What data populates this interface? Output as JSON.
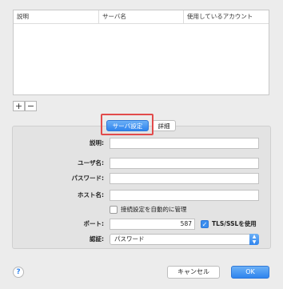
{
  "table": {
    "columns": [
      "説明",
      "サーバ名",
      "使用しているアカウント"
    ]
  },
  "list_controls": {
    "add": "+",
    "remove": "−"
  },
  "tabs": {
    "server_settings": "サーバ設定",
    "details": "詳細"
  },
  "form": {
    "description_label": "説明:",
    "username_label": "ユーザ名:",
    "password_label": "パスワード:",
    "hostname_label": "ホスト名:",
    "auto_manage_label": "接続設定を自動的に管理",
    "port_label": "ポート:",
    "port_value": "587",
    "tls_label": "TLS/SSLを使用",
    "auth_label": "認証:",
    "auth_value": "パスワード"
  },
  "footer": {
    "help": "?",
    "cancel": "キャンセル",
    "ok": "OK"
  },
  "colors": {
    "accent": "#2f84ee",
    "highlight_box": "#e24b4b"
  }
}
